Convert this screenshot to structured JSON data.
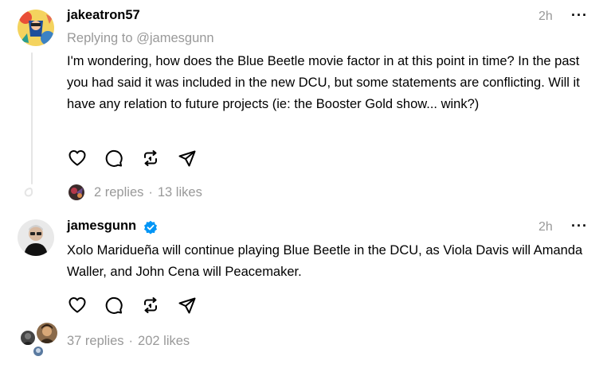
{
  "posts": [
    {
      "username": "jakeatron57",
      "time": "2h",
      "more_label": "···",
      "replying_to": "Replying to @jamesgunn",
      "text": "I'm wondering, how does the Blue Beetle movie factor in at this point in time? In the past you had said it was included in the new DCU, but some statements are conflicting. Will it have any relation to future projects (ie: the Booster Gold show... wink?)",
      "replies": "2 replies",
      "separator": "·",
      "likes": "13 likes"
    },
    {
      "username": "jamesgunn",
      "verified": true,
      "time": "2h",
      "more_label": "···",
      "text": "Xolo Maridueña will continue playing Blue Beetle in the DCU, as Viola Davis will Amanda Waller, and John Cena will Peacemaker.",
      "replies": "37 replies",
      "separator": "·",
      "likes": "202 likes"
    }
  ],
  "colors": {
    "text": "#000000",
    "muted": "#999999",
    "verified": "#0095f6",
    "thread_line": "#e5e5e5"
  },
  "icons": [
    "heart-icon",
    "comment-icon",
    "repost-icon",
    "share-icon",
    "verified-badge-icon",
    "thread-loop-icon"
  ]
}
